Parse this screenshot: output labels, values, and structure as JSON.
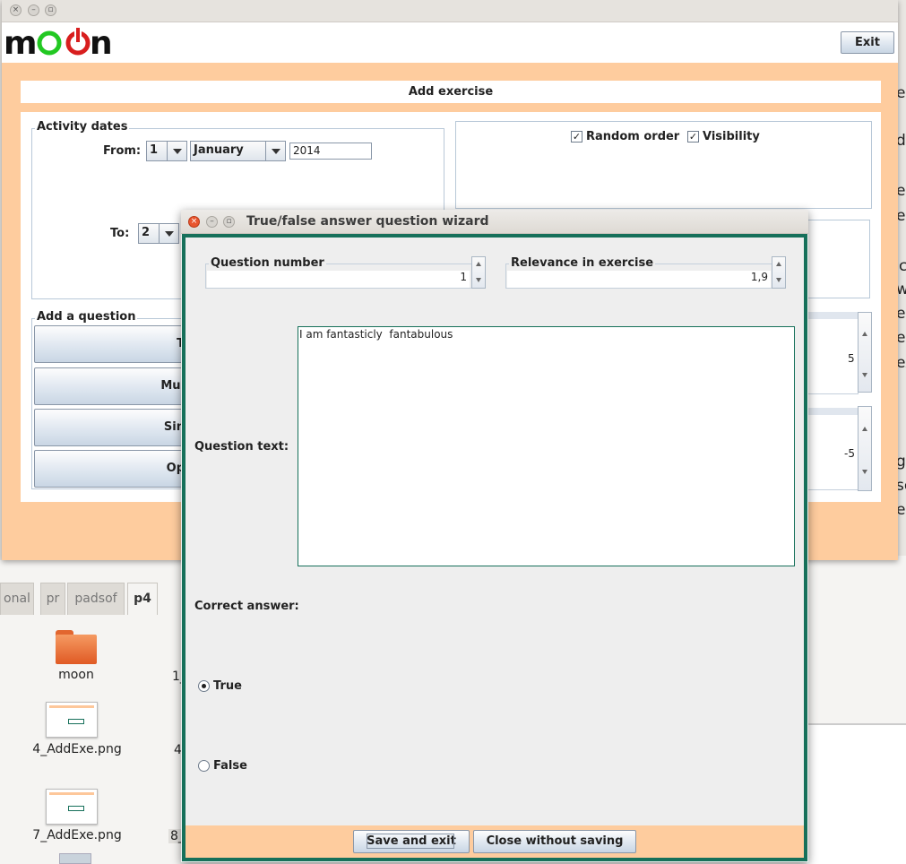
{
  "main_window": {
    "logo_text": "moon",
    "exit_label": "Exit",
    "panel_title": "Add exercise"
  },
  "activity_dates": {
    "legend": "Activity dates",
    "from_label": "From:",
    "from_day": "1",
    "from_month": "January",
    "from_year": "2014",
    "to_label": "To:",
    "to_day": "2"
  },
  "options": {
    "random_order_label": "Random order",
    "visibility_label": "Visibility"
  },
  "add_question": {
    "legend": "Add a question",
    "buttons": [
      "T",
      "Mul",
      "Sin",
      "Op"
    ]
  },
  "behind_spinners": {
    "value1": "5",
    "value2": "-5"
  },
  "right_edge_chars": [
    "e",
    "d",
    "el",
    "ed",
    "c",
    "w",
    "e",
    "e",
    "ex",
    "gi",
    "se",
    "el"
  ],
  "file_manager": {
    "tabs": [
      "onal",
      "pr",
      "padsof",
      "p4"
    ],
    "files": [
      {
        "name": "moon",
        "type": "folder"
      },
      {
        "name": "4_AddExe.png",
        "type": "image"
      },
      {
        "name": "7_AddExe.png",
        "type": "image"
      }
    ],
    "side_labels": [
      "1_",
      "4",
      "8_"
    ]
  },
  "dialog": {
    "title": "True/false answer question wizard",
    "question_number_label": "Question number",
    "question_number_value": "1",
    "relevance_label": "Relevance in exercise",
    "relevance_value": "1,9",
    "question_text_label": "Question text:",
    "question_text_value": "I am fantasticly  fantabulous",
    "correct_answer_label": "Correct answer:",
    "true_label": "True",
    "false_label": "False",
    "selected_answer": "True",
    "save_label": "Save and exit",
    "close_label": "Close without saving"
  },
  "colors": {
    "peach": "#fecc9e",
    "dialog_border": "#16705a",
    "title_bar": "#e6e3de"
  },
  "icons": [
    "close-icon",
    "minimize-icon",
    "maximize-icon",
    "power-icon",
    "folder-icon",
    "image-file-icon",
    "checkbox-checked-icon",
    "chevron-down-icon"
  ]
}
